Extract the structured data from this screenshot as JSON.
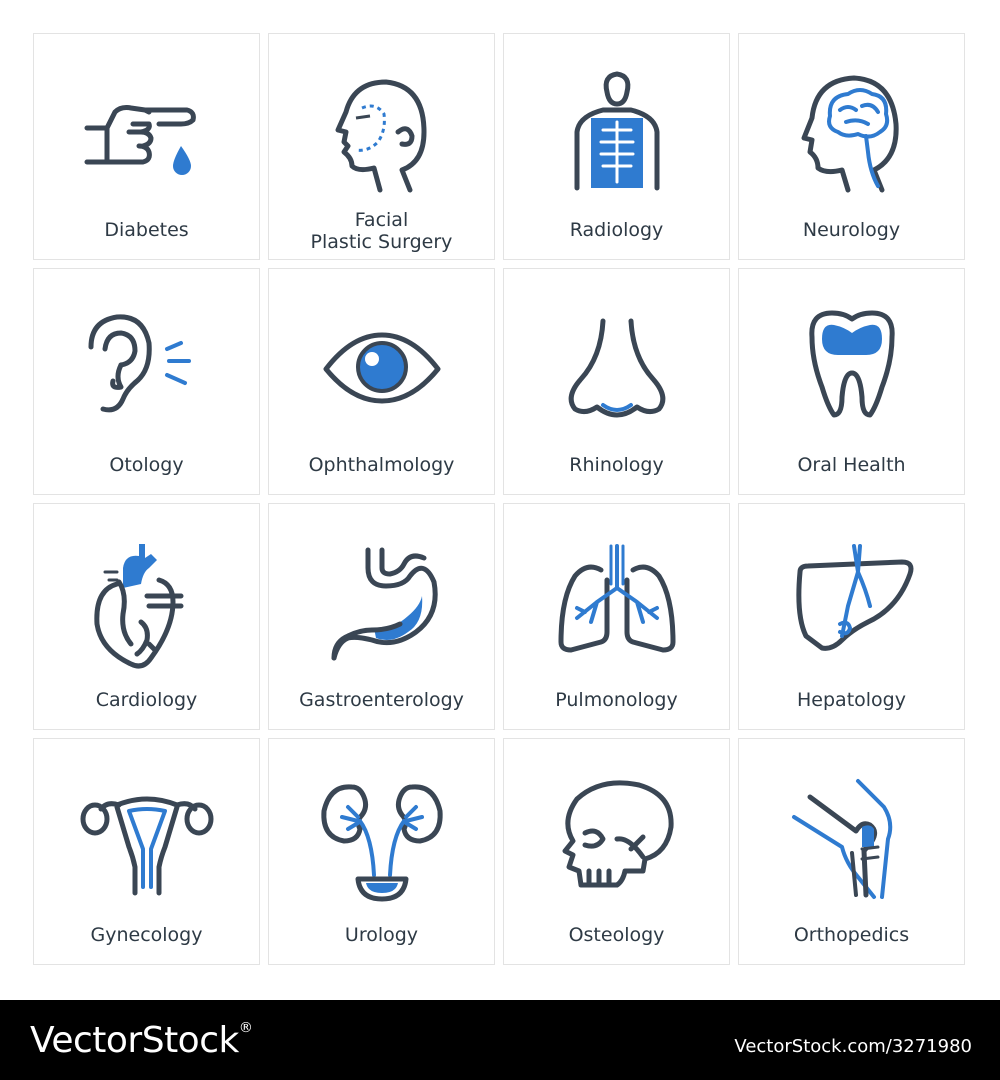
{
  "colors": {
    "icon_dark": "#3a4654",
    "accent_blue": "#2f7bd0",
    "label": "#2e3a45"
  },
  "tiles": [
    {
      "label": "Diabetes",
      "icon": "finger-blood-drop-icon"
    },
    {
      "label": "Facial\nPlastic Surgery",
      "icon": "face-profile-icon"
    },
    {
      "label": "Radiology",
      "icon": "xray-person-icon"
    },
    {
      "label": "Neurology",
      "icon": "brain-head-icon"
    },
    {
      "label": "Otology",
      "icon": "ear-icon"
    },
    {
      "label": "Ophthalmology",
      "icon": "eye-icon"
    },
    {
      "label": "Rhinology",
      "icon": "nose-icon"
    },
    {
      "label": "Oral Health",
      "icon": "tooth-icon"
    },
    {
      "label": "Cardiology",
      "icon": "heart-icon"
    },
    {
      "label": "Gastroenterology",
      "icon": "stomach-icon"
    },
    {
      "label": "Pulmonology",
      "icon": "lungs-icon"
    },
    {
      "label": "Hepatology",
      "icon": "liver-icon"
    },
    {
      "label": "Gynecology",
      "icon": "uterus-icon"
    },
    {
      "label": "Urology",
      "icon": "kidneys-icon"
    },
    {
      "label": "Osteology",
      "icon": "skull-icon"
    },
    {
      "label": "Orthopedics",
      "icon": "knee-joint-icon"
    }
  ],
  "footer": {
    "brand": "VectorStock",
    "registered": "®",
    "id": "VectorStock.com/3271980"
  }
}
